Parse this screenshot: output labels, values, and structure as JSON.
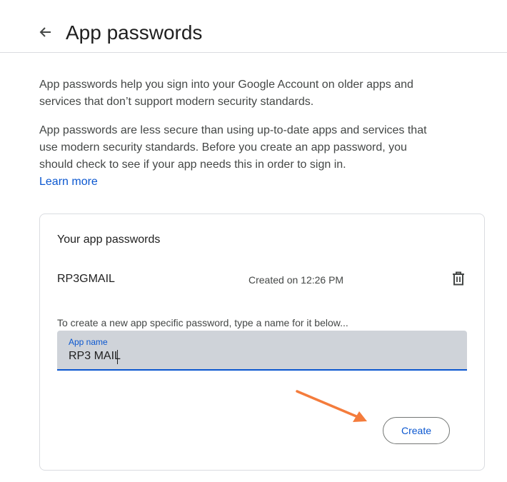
{
  "header": {
    "back_icon": "arrow-left-icon",
    "title": "App passwords"
  },
  "intro": {
    "paragraph1": "App passwords help you sign into your Google Account on older apps and services that don’t support modern security standards.",
    "paragraph2": "App passwords are less secure than using up-to-date apps and services that use modern security standards. Before you create an app password, you should check to see if your app needs this in order to sign in.",
    "learn_more": "Learn more"
  },
  "card": {
    "title": "Your app passwords",
    "passwords": [
      {
        "name": "RP3GMAIL",
        "created": "Created on 12:26 PM",
        "delete_icon": "trash-icon"
      }
    ],
    "hint": "To create a new app specific password, type a name for it below...",
    "field": {
      "label": "App name",
      "value": "RP3 MAIL"
    },
    "create_label": "Create"
  },
  "annotation": {
    "arrow_color": "#f47c3c"
  },
  "colors": {
    "accent": "#0b57d0",
    "field_bg": "#cfd3d9",
    "border": "#dadce0"
  }
}
